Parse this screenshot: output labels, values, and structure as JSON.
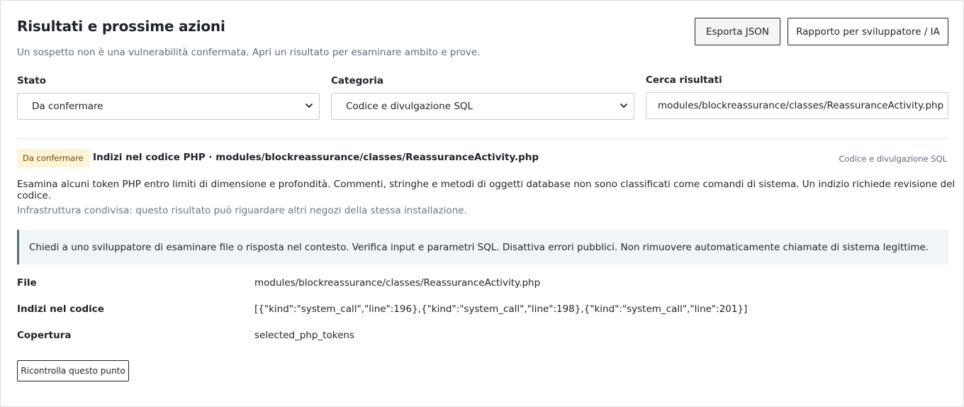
{
  "header": {
    "title": "Risultati e prossime azioni",
    "subtitle": "Un sospetto non è una vulnerabilità confermata. Apri un risultato per esaminare ambito e prove.",
    "export_label": "Esporta JSON",
    "report_label": "Rapporto per sviluppatore / IA"
  },
  "filters": {
    "stato_label": "Stato",
    "stato_value": "Da confermare",
    "categoria_label": "Categoria",
    "categoria_value": "Codice e divulgazione SQL",
    "search_label": "Cerca risultati",
    "search_value": "modules/blockreassurance/classes/ReassuranceActivity.php"
  },
  "finding": {
    "badge": "Da confermare",
    "title": "Indizi nel codice PHP · modules/blockreassurance/classes/ReassuranceActivity.php",
    "category": "Codice e divulgazione SQL",
    "description": "Esamina alcuni token PHP entro limiti di dimensione e profondità. Commenti, stringhe e metodi di oggetti database non sono classificati come comandi di sistema. Un indizio richiede revisione del codice.",
    "infra_note": "Infrastruttura condivisa: questo risultato può riguardare altri negozi della stessa installazione.",
    "callout": "Chiedi a uno sviluppatore di esaminare file o risposta nel contesto. Verifica input e parametri SQL. Disattiva errori pubblici. Non rimuovere automaticamente chiamate di sistema legittime.",
    "details": [
      {
        "key": "File",
        "value": "modules/blockreassurance/classes/ReassuranceActivity.php"
      },
      {
        "key": "Indizi nel codice",
        "value": "[{\"kind\":\"system_call\",\"line\":196},{\"kind\":\"system_call\",\"line\":198},{\"kind\":\"system_call\",\"line\":201}]"
      },
      {
        "key": "Copertura",
        "value": "selected_php_tokens"
      }
    ],
    "recheck_label": "Ricontrolla questo punto"
  }
}
